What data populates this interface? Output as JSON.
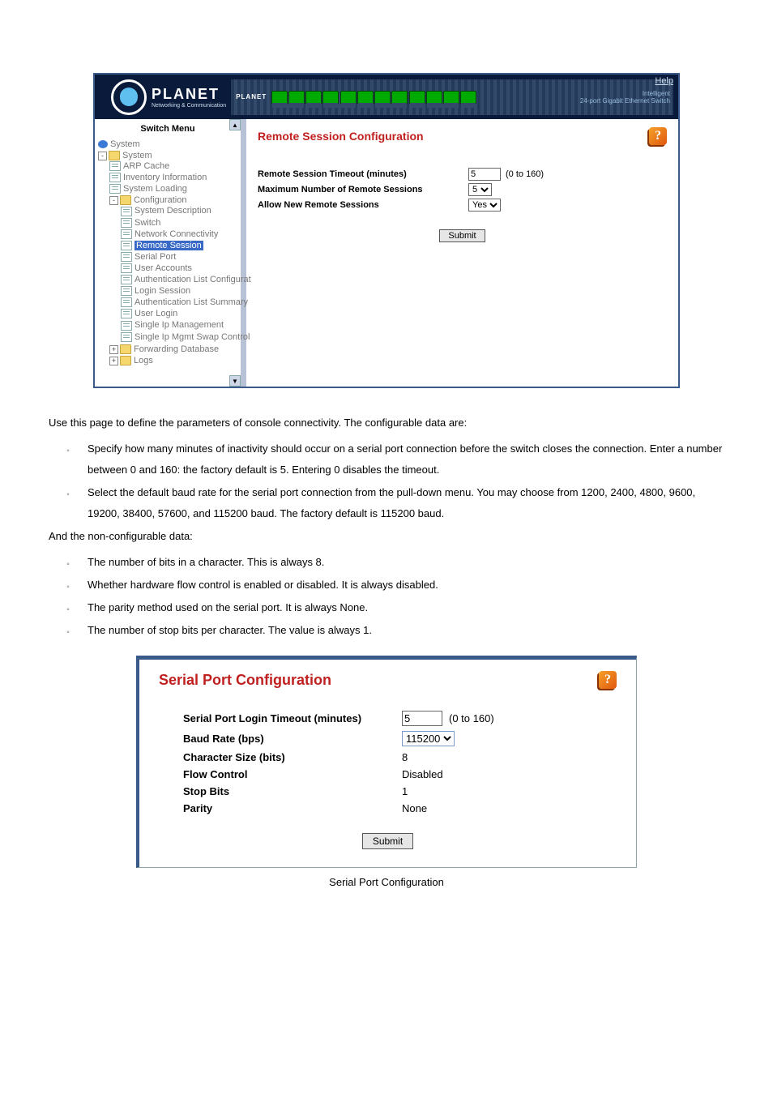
{
  "app1": {
    "help_link": "Help",
    "logo_main": "PLANET",
    "logo_sub": "Networking & Communication",
    "header_mini": "PLANET",
    "header_desc1": "Intelligent",
    "header_desc2": "24-port Gigabit Ethernet Switch",
    "switch_menu": "Switch Menu",
    "tree": {
      "system_root": "System",
      "system": "System",
      "arp": "ARP Cache",
      "inv": "Inventory Information",
      "sysload": "System Loading",
      "config": "Configuration",
      "sysdesc": "System Description",
      "switch": "Switch",
      "netconn": "Network Connectivity",
      "remote": "Remote Session",
      "serial": "Serial Port",
      "uacct": "User Accounts",
      "authcfg": "Authentication List Configurat",
      "login": "Login Session",
      "authsum": "Authentication List Summary",
      "ulogin": "User Login",
      "sip": "Single Ip Management",
      "sipswap": "Single Ip Mgmt Swap Control",
      "fdb": "Forwarding Database",
      "logs": "Logs"
    },
    "pane_title": "Remote Session Configuration",
    "form": {
      "row1": "Remote Session Timeout (minutes)",
      "row1_val": "5",
      "row1_range": "(0 to 160)",
      "row2": "Maximum Number of Remote Sessions",
      "row2_val": "5",
      "row3": "Allow New Remote Sessions",
      "row3_val": "Yes"
    },
    "submit": "Submit"
  },
  "doc": {
    "intro": "Use this page to define the parameters of console connectivity. The configurable data are:",
    "c1": "Specify how many minutes of inactivity should occur on a serial port connection before the switch closes the connection. Enter a number between 0 and 160: the factory default is 5. Entering 0 disables the timeout.",
    "c2": "Select the default baud rate for the serial port connection from the pull-down menu. You may choose from 1200, 2400, 4800, 9600, 19200, 38400, 57600, and 115200 baud. The factory default is 115200 baud.",
    "nc_intro": "And the non-configurable data:",
    "nc1": "The number of bits in a character. This is always 8.",
    "nc2": "Whether hardware flow control is enabled or disabled. It is always disabled.",
    "nc3": "The parity method used on the serial port. It is always None.",
    "nc4": "The number of stop bits per character. The value is always 1."
  },
  "app2": {
    "title": "Serial Port Configuration",
    "labels": {
      "timeout": "Serial Port Login Timeout (minutes)",
      "baud": "Baud Rate (bps)",
      "char": "Character Size (bits)",
      "flow": "Flow Control",
      "stop": "Stop Bits",
      "parity": "Parity"
    },
    "values": {
      "timeout": "5",
      "timeout_range": "(0 to 160)",
      "baud": "115200",
      "char": "8",
      "flow": "Disabled",
      "stop": "1",
      "parity": "None"
    },
    "submit": "Submit"
  },
  "caption": "Serial Port Configuration"
}
